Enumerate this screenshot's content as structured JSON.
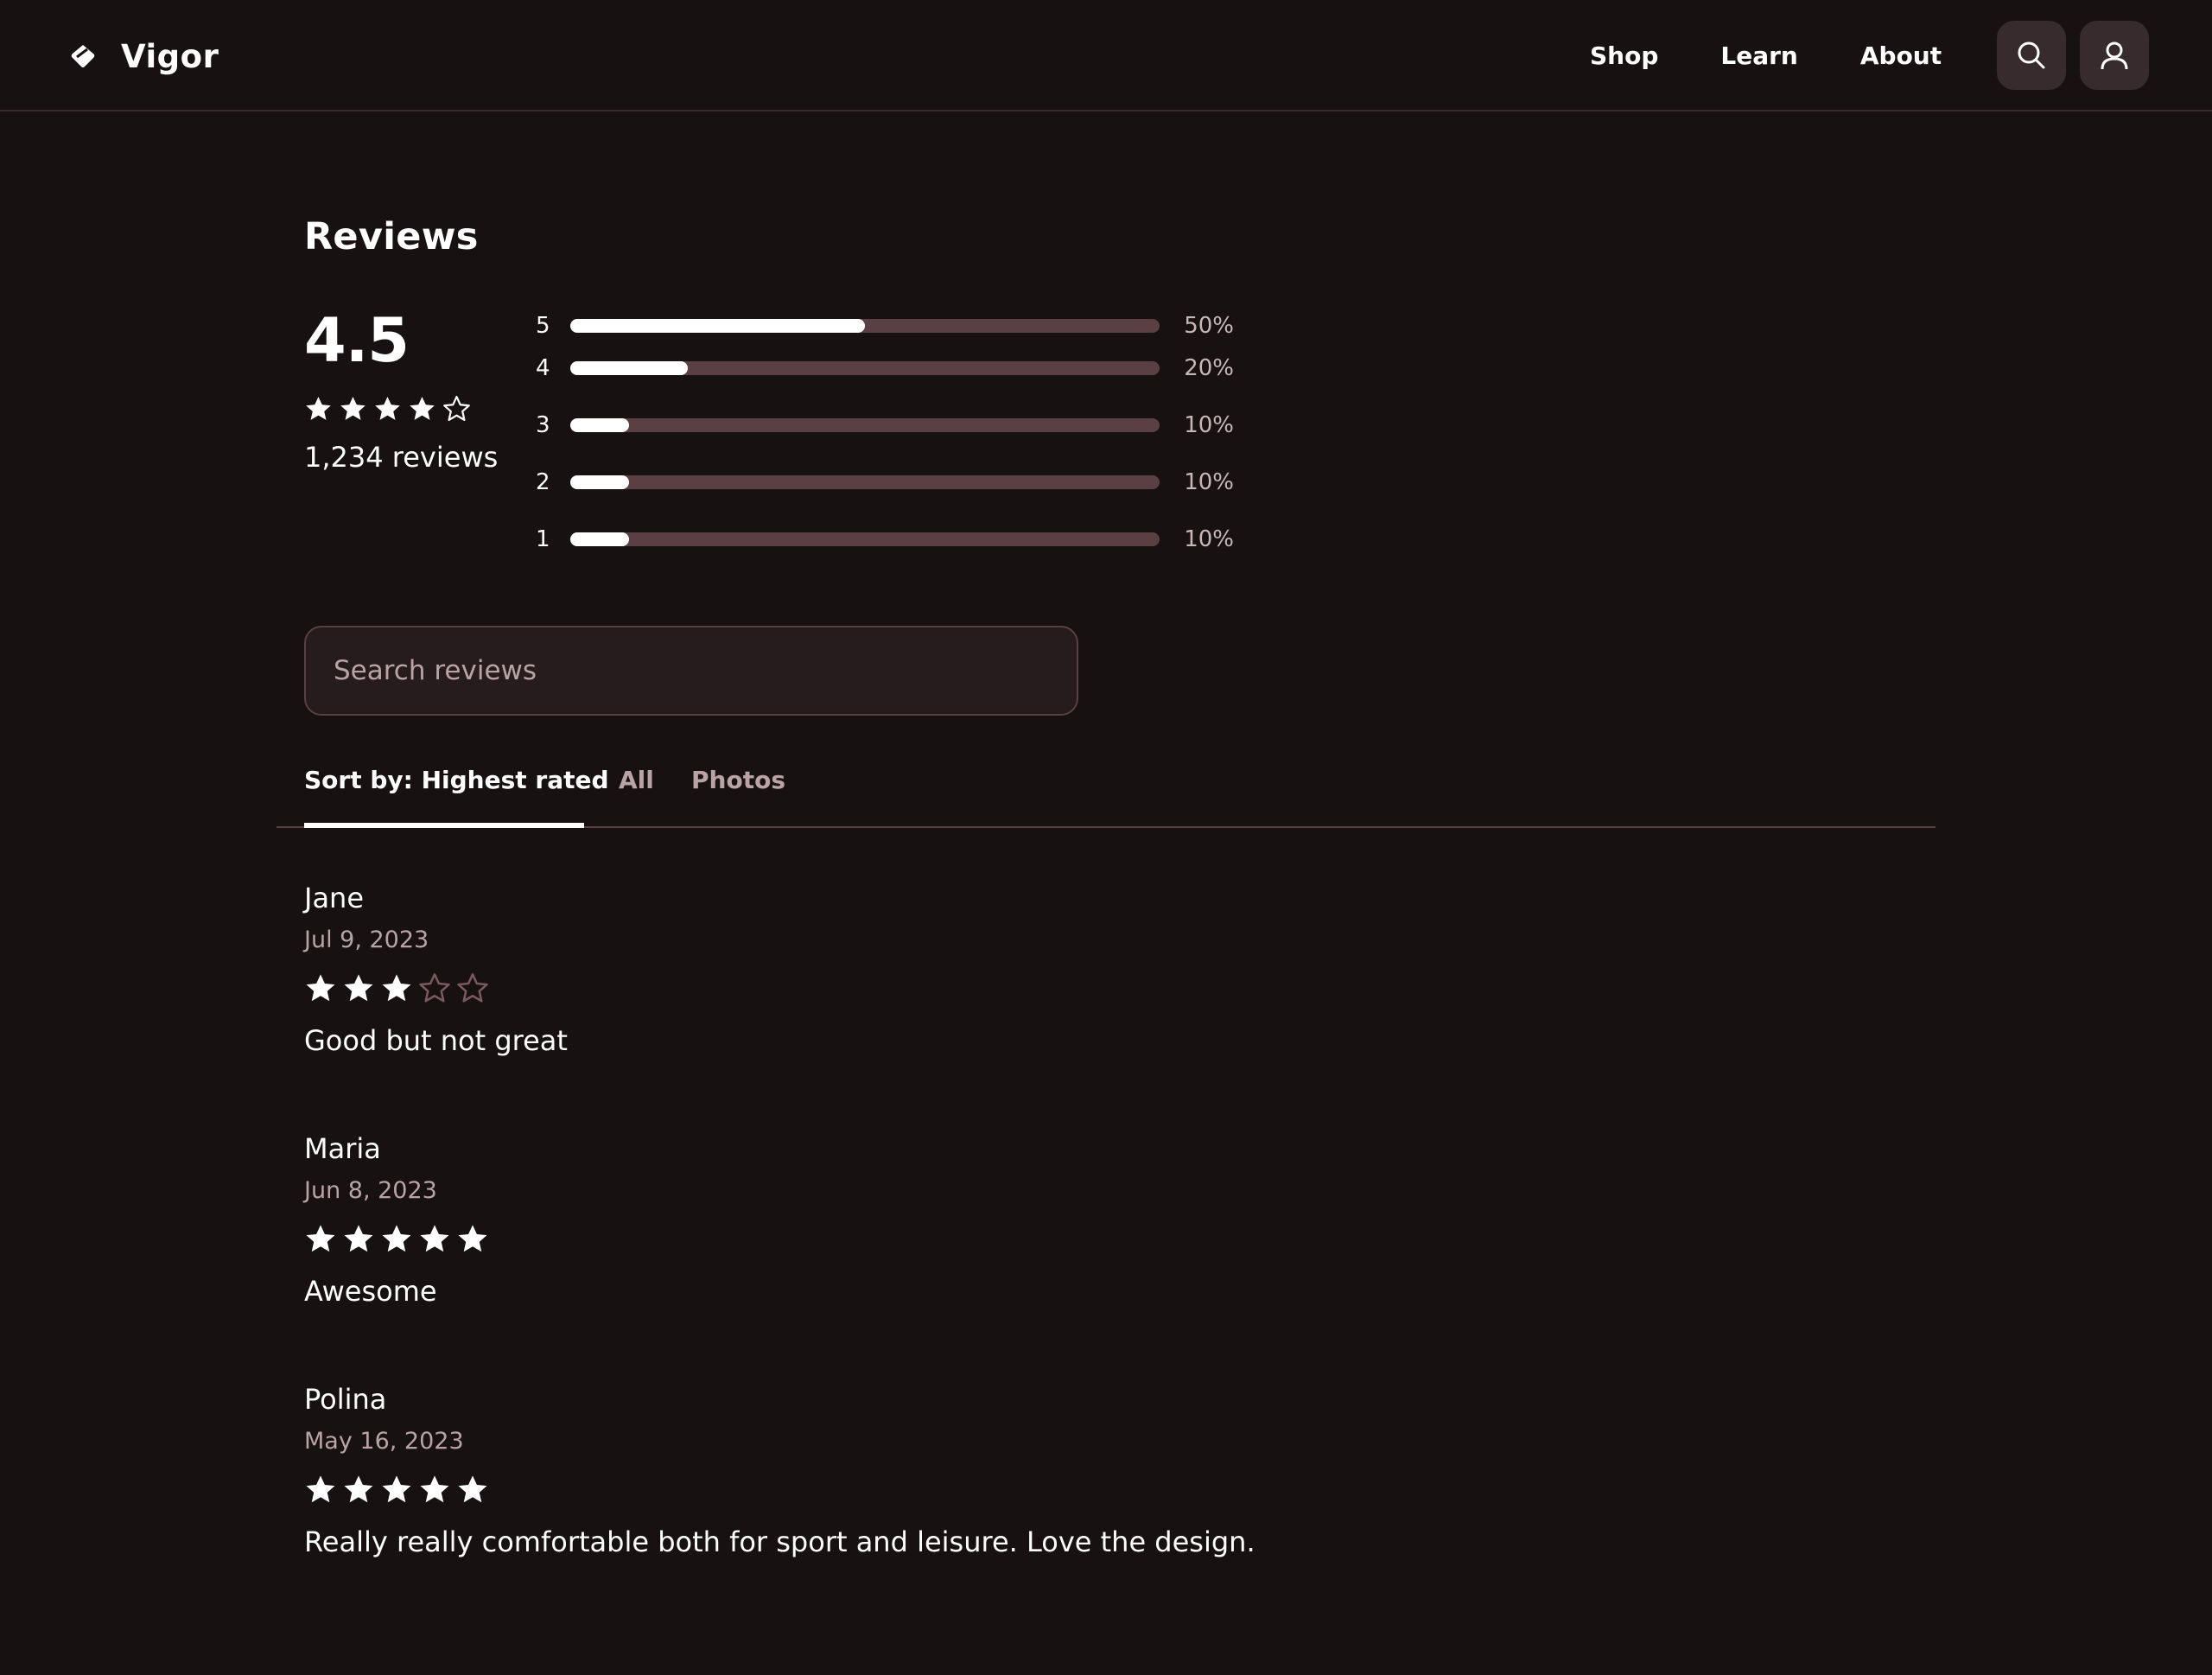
{
  "header": {
    "brand": "Vigor",
    "nav": [
      "Shop",
      "Learn",
      "About"
    ]
  },
  "reviews_section": {
    "title": "Reviews",
    "average": "4.5",
    "average_stars": 4.5,
    "count_text": "1,234 reviews",
    "distribution": [
      {
        "label": "5",
        "percent_text": "50%",
        "fill": 0.5
      },
      {
        "label": "4",
        "percent_text": "20%",
        "fill": 0.2
      },
      {
        "label": "3",
        "percent_text": "10%",
        "fill": 0.1
      },
      {
        "label": "2",
        "percent_text": "10%",
        "fill": 0.1
      },
      {
        "label": "1",
        "percent_text": "10%",
        "fill": 0.1
      }
    ],
    "search_placeholder": "Search reviews",
    "tabs": [
      "Sort by: Highest rated",
      "All",
      "Photos"
    ],
    "active_tab": 0
  },
  "reviews": [
    {
      "name": "Jane",
      "date": "Jul 9, 2023",
      "rating": 3,
      "text": "Good but not great"
    },
    {
      "name": "Maria",
      "date": "Jun 8, 2023",
      "rating": 5,
      "text": "Awesome"
    },
    {
      "name": "Polina",
      "date": "May 16, 2023",
      "rating": 5,
      "text": "Really really comfortable both for sport and leisure. Love the design."
    }
  ],
  "colors": {
    "background": "#181112",
    "surface": "#382b2d",
    "track": "#5a4042",
    "muted_text": "#b9a3a6",
    "text": "#ffffff"
  },
  "icons": [
    "logo-icon",
    "search-icon",
    "user-icon",
    "star-filled-icon",
    "star-outline-icon"
  ]
}
